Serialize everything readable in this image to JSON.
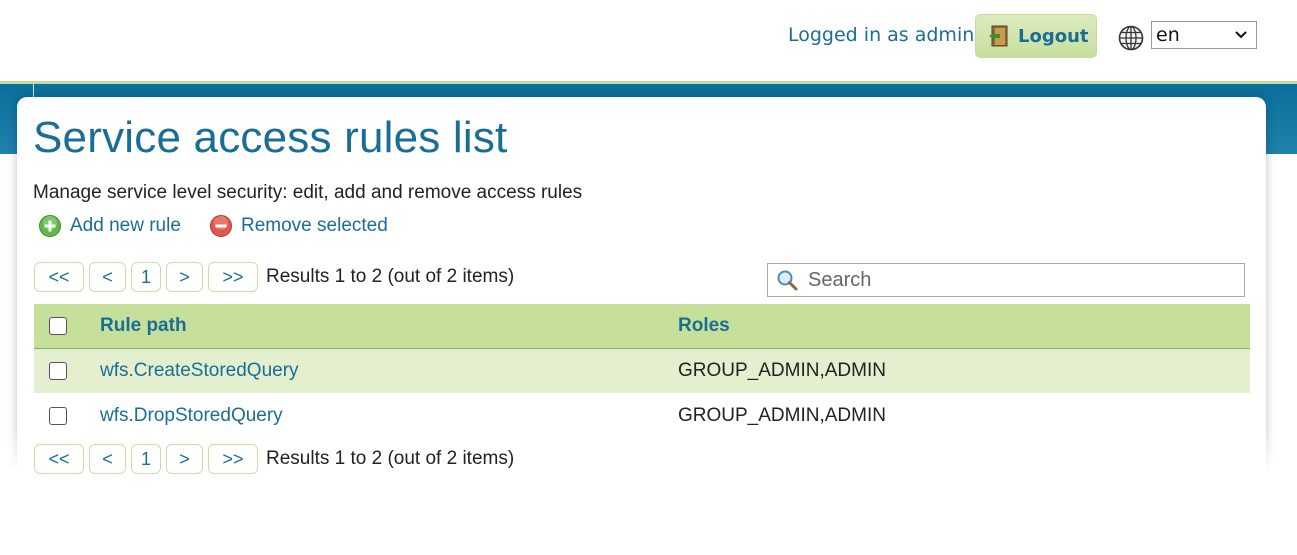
{
  "header": {
    "logged_in_text": "Logged in as admin.",
    "logout_label": "Logout",
    "language_value": "en"
  },
  "page": {
    "title": "Service access rules list",
    "subtitle": "Manage service level security: edit, add and remove access rules",
    "add_label": "Add new rule",
    "remove_label": "Remove selected"
  },
  "pager": {
    "first": "<<",
    "prev": "<",
    "current": "1",
    "next": ">",
    "last": ">>",
    "info": "Results 1 to 2 (out of 2 items)"
  },
  "search": {
    "placeholder": "Search"
  },
  "table": {
    "headers": {
      "path": "Rule path",
      "roles": "Roles"
    },
    "rows": [
      {
        "path": "wfs.CreateStoredQuery",
        "roles": "GROUP_ADMIN,ADMIN"
      },
      {
        "path": "wfs.DropStoredQuery",
        "roles": "GROUP_ADMIN,ADMIN"
      }
    ]
  },
  "icons": {
    "logout": "door-exit-icon",
    "language": "globe-icon",
    "add": "plus-circle-icon",
    "remove": "minus-circle-icon",
    "search": "magnifier-icon"
  },
  "colors": {
    "link": "#1a6e96",
    "header_band": "#157aa5",
    "table_header": "#c6df9b",
    "row_highlight": "#e3efcf"
  }
}
